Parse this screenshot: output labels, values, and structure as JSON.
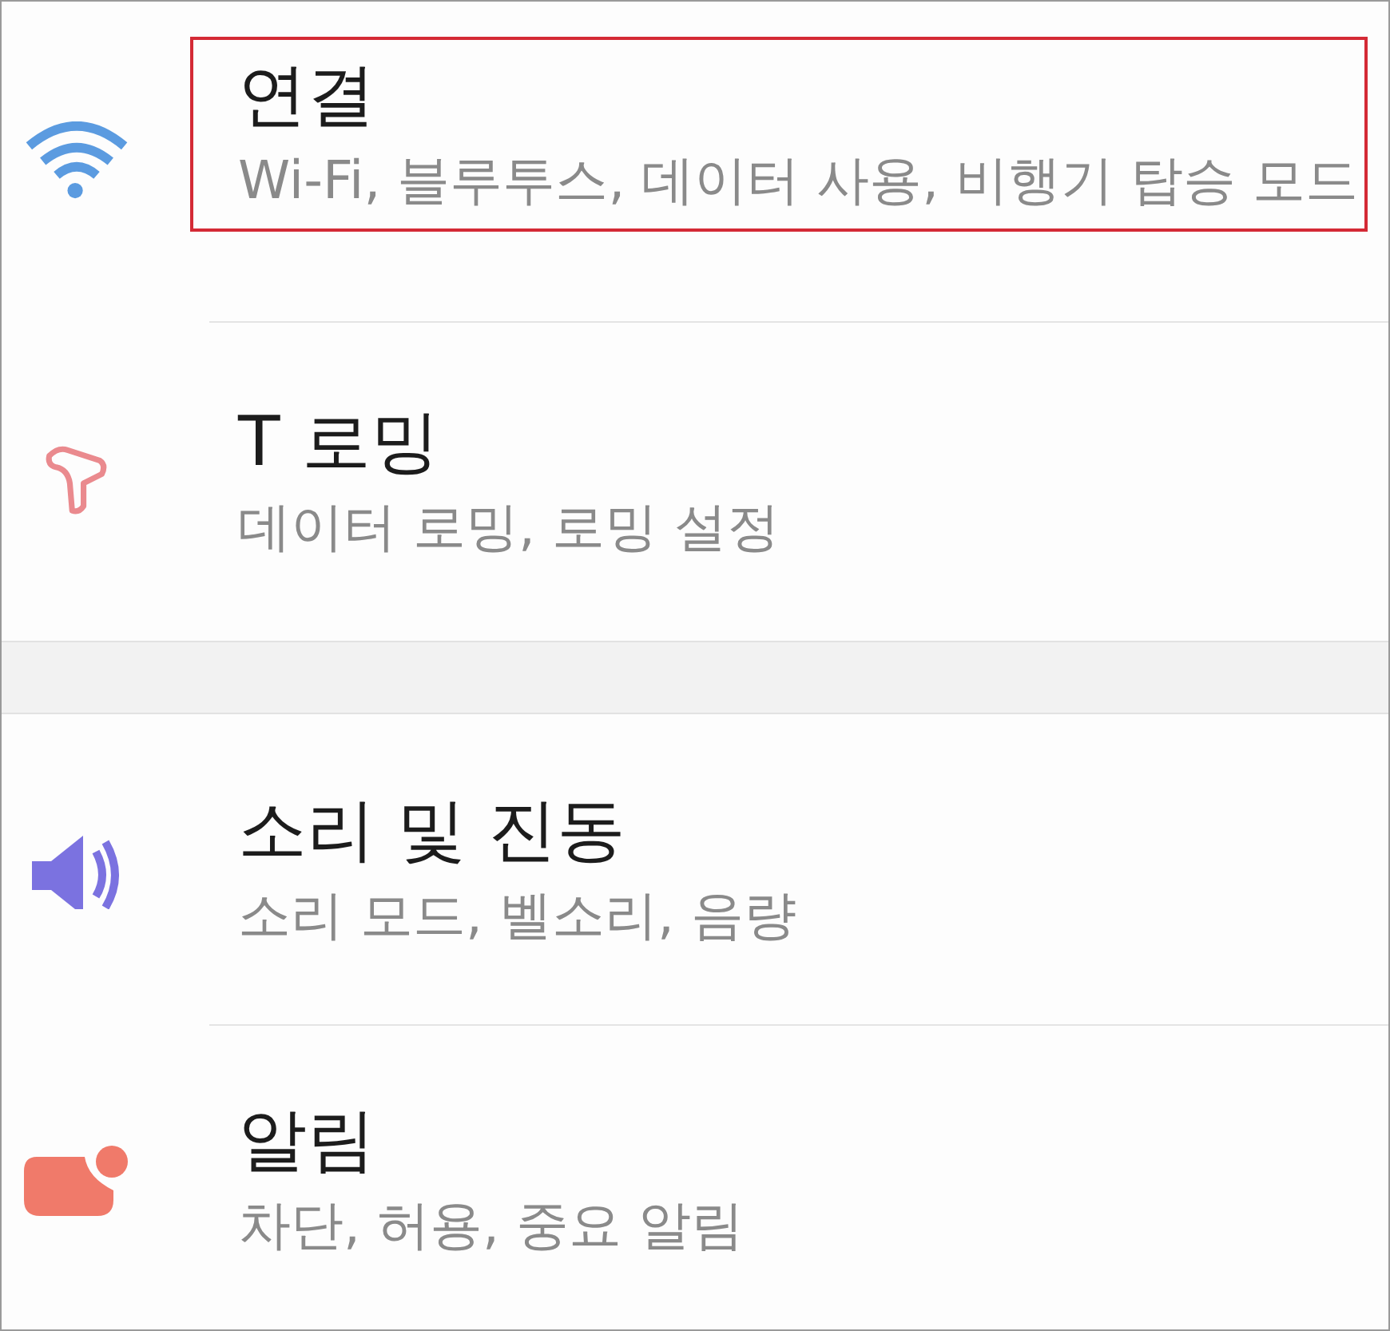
{
  "groups": [
    {
      "items": [
        {
          "kind": "wifi",
          "title": "연결",
          "subtitle": "Wi-Fi, 블루투스, 데이터 사용, 비행기 탑승 모드",
          "highlighted": true
        },
        {
          "kind": "roaming",
          "title": "T 로밍",
          "subtitle": "데이터 로밍, 로밍 설정",
          "highlighted": false
        }
      ]
    },
    {
      "items": [
        {
          "kind": "sound",
          "title": "소리 및 진동",
          "subtitle": "소리 모드, 벨소리, 음량",
          "highlighted": false
        },
        {
          "kind": "notification",
          "title": "알림",
          "subtitle": "차단, 허용, 중요 알림",
          "highlighted": false
        }
      ]
    }
  ]
}
